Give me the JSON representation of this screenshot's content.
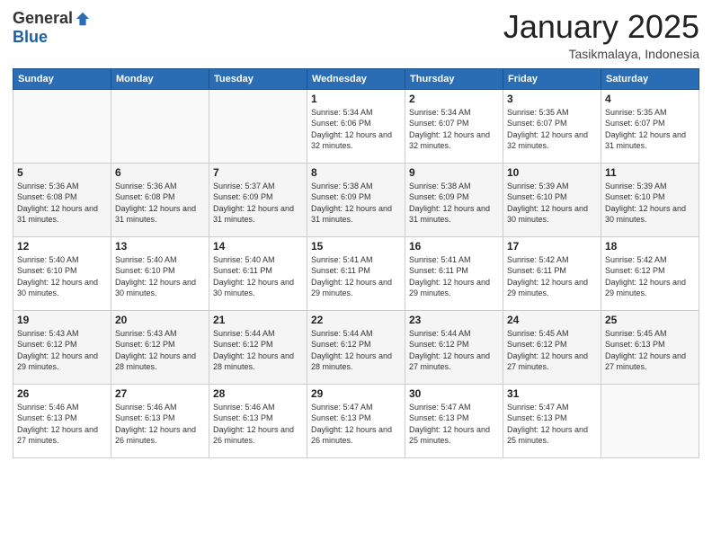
{
  "header": {
    "logo_general": "General",
    "logo_blue": "Blue",
    "month_title": "January 2025",
    "subtitle": "Tasikmalaya, Indonesia"
  },
  "weekdays": [
    "Sunday",
    "Monday",
    "Tuesday",
    "Wednesday",
    "Thursday",
    "Friday",
    "Saturday"
  ],
  "weeks": [
    [
      {
        "day": "",
        "sunrise": "",
        "sunset": "",
        "daylight": ""
      },
      {
        "day": "",
        "sunrise": "",
        "sunset": "",
        "daylight": ""
      },
      {
        "day": "",
        "sunrise": "",
        "sunset": "",
        "daylight": ""
      },
      {
        "day": "1",
        "sunrise": "Sunrise: 5:34 AM",
        "sunset": "Sunset: 6:06 PM",
        "daylight": "Daylight: 12 hours and 32 minutes."
      },
      {
        "day": "2",
        "sunrise": "Sunrise: 5:34 AM",
        "sunset": "Sunset: 6:07 PM",
        "daylight": "Daylight: 12 hours and 32 minutes."
      },
      {
        "day": "3",
        "sunrise": "Sunrise: 5:35 AM",
        "sunset": "Sunset: 6:07 PM",
        "daylight": "Daylight: 12 hours and 32 minutes."
      },
      {
        "day": "4",
        "sunrise": "Sunrise: 5:35 AM",
        "sunset": "Sunset: 6:07 PM",
        "daylight": "Daylight: 12 hours and 31 minutes."
      }
    ],
    [
      {
        "day": "5",
        "sunrise": "Sunrise: 5:36 AM",
        "sunset": "Sunset: 6:08 PM",
        "daylight": "Daylight: 12 hours and 31 minutes."
      },
      {
        "day": "6",
        "sunrise": "Sunrise: 5:36 AM",
        "sunset": "Sunset: 6:08 PM",
        "daylight": "Daylight: 12 hours and 31 minutes."
      },
      {
        "day": "7",
        "sunrise": "Sunrise: 5:37 AM",
        "sunset": "Sunset: 6:09 PM",
        "daylight": "Daylight: 12 hours and 31 minutes."
      },
      {
        "day": "8",
        "sunrise": "Sunrise: 5:38 AM",
        "sunset": "Sunset: 6:09 PM",
        "daylight": "Daylight: 12 hours and 31 minutes."
      },
      {
        "day": "9",
        "sunrise": "Sunrise: 5:38 AM",
        "sunset": "Sunset: 6:09 PM",
        "daylight": "Daylight: 12 hours and 31 minutes."
      },
      {
        "day": "10",
        "sunrise": "Sunrise: 5:39 AM",
        "sunset": "Sunset: 6:10 PM",
        "daylight": "Daylight: 12 hours and 30 minutes."
      },
      {
        "day": "11",
        "sunrise": "Sunrise: 5:39 AM",
        "sunset": "Sunset: 6:10 PM",
        "daylight": "Daylight: 12 hours and 30 minutes."
      }
    ],
    [
      {
        "day": "12",
        "sunrise": "Sunrise: 5:40 AM",
        "sunset": "Sunset: 6:10 PM",
        "daylight": "Daylight: 12 hours and 30 minutes."
      },
      {
        "day": "13",
        "sunrise": "Sunrise: 5:40 AM",
        "sunset": "Sunset: 6:10 PM",
        "daylight": "Daylight: 12 hours and 30 minutes."
      },
      {
        "day": "14",
        "sunrise": "Sunrise: 5:40 AM",
        "sunset": "Sunset: 6:11 PM",
        "daylight": "Daylight: 12 hours and 30 minutes."
      },
      {
        "day": "15",
        "sunrise": "Sunrise: 5:41 AM",
        "sunset": "Sunset: 6:11 PM",
        "daylight": "Daylight: 12 hours and 29 minutes."
      },
      {
        "day": "16",
        "sunrise": "Sunrise: 5:41 AM",
        "sunset": "Sunset: 6:11 PM",
        "daylight": "Daylight: 12 hours and 29 minutes."
      },
      {
        "day": "17",
        "sunrise": "Sunrise: 5:42 AM",
        "sunset": "Sunset: 6:11 PM",
        "daylight": "Daylight: 12 hours and 29 minutes."
      },
      {
        "day": "18",
        "sunrise": "Sunrise: 5:42 AM",
        "sunset": "Sunset: 6:12 PM",
        "daylight": "Daylight: 12 hours and 29 minutes."
      }
    ],
    [
      {
        "day": "19",
        "sunrise": "Sunrise: 5:43 AM",
        "sunset": "Sunset: 6:12 PM",
        "daylight": "Daylight: 12 hours and 29 minutes."
      },
      {
        "day": "20",
        "sunrise": "Sunrise: 5:43 AM",
        "sunset": "Sunset: 6:12 PM",
        "daylight": "Daylight: 12 hours and 28 minutes."
      },
      {
        "day": "21",
        "sunrise": "Sunrise: 5:44 AM",
        "sunset": "Sunset: 6:12 PM",
        "daylight": "Daylight: 12 hours and 28 minutes."
      },
      {
        "day": "22",
        "sunrise": "Sunrise: 5:44 AM",
        "sunset": "Sunset: 6:12 PM",
        "daylight": "Daylight: 12 hours and 28 minutes."
      },
      {
        "day": "23",
        "sunrise": "Sunrise: 5:44 AM",
        "sunset": "Sunset: 6:12 PM",
        "daylight": "Daylight: 12 hours and 27 minutes."
      },
      {
        "day": "24",
        "sunrise": "Sunrise: 5:45 AM",
        "sunset": "Sunset: 6:12 PM",
        "daylight": "Daylight: 12 hours and 27 minutes."
      },
      {
        "day": "25",
        "sunrise": "Sunrise: 5:45 AM",
        "sunset": "Sunset: 6:13 PM",
        "daylight": "Daylight: 12 hours and 27 minutes."
      }
    ],
    [
      {
        "day": "26",
        "sunrise": "Sunrise: 5:46 AM",
        "sunset": "Sunset: 6:13 PM",
        "daylight": "Daylight: 12 hours and 27 minutes."
      },
      {
        "day": "27",
        "sunrise": "Sunrise: 5:46 AM",
        "sunset": "Sunset: 6:13 PM",
        "daylight": "Daylight: 12 hours and 26 minutes."
      },
      {
        "day": "28",
        "sunrise": "Sunrise: 5:46 AM",
        "sunset": "Sunset: 6:13 PM",
        "daylight": "Daylight: 12 hours and 26 minutes."
      },
      {
        "day": "29",
        "sunrise": "Sunrise: 5:47 AM",
        "sunset": "Sunset: 6:13 PM",
        "daylight": "Daylight: 12 hours and 26 minutes."
      },
      {
        "day": "30",
        "sunrise": "Sunrise: 5:47 AM",
        "sunset": "Sunset: 6:13 PM",
        "daylight": "Daylight: 12 hours and 25 minutes."
      },
      {
        "day": "31",
        "sunrise": "Sunrise: 5:47 AM",
        "sunset": "Sunset: 6:13 PM",
        "daylight": "Daylight: 12 hours and 25 minutes."
      },
      {
        "day": "",
        "sunrise": "",
        "sunset": "",
        "daylight": ""
      }
    ]
  ]
}
